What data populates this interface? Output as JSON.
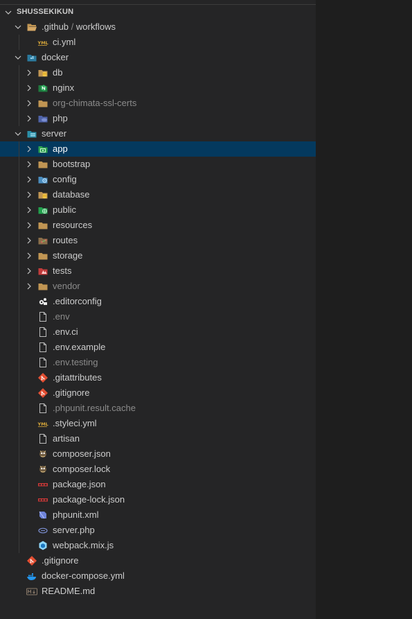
{
  "explorer": {
    "title": "SHUSSEKIKUN",
    "colors": {
      "background": "#252526",
      "selected": "#04395e",
      "text": "#cccccc",
      "dimmed": "#8b8b8b",
      "folder": "#c09553"
    },
    "items": [
      {
        "name": ".github",
        "label2": "workflows",
        "indent": 1,
        "kind": "folder",
        "expanded": true,
        "icon": "folder-open-icon"
      },
      {
        "name": "ci.yml",
        "indent": 2,
        "kind": "file",
        "icon": "yaml-icon"
      },
      {
        "name": "docker",
        "indent": 1,
        "kind": "folder",
        "expanded": true,
        "icon": "docker-folder-icon"
      },
      {
        "name": "db",
        "indent": 2,
        "kind": "folder",
        "expanded": false,
        "icon": "database-folder-icon"
      },
      {
        "name": "nginx",
        "indent": 2,
        "kind": "folder",
        "expanded": false,
        "icon": "nginx-folder-icon"
      },
      {
        "name": "org-chimata-ssl-certs",
        "indent": 2,
        "kind": "folder",
        "expanded": false,
        "icon": "folder-icon",
        "dimmed": true
      },
      {
        "name": "php",
        "indent": 2,
        "kind": "folder",
        "expanded": false,
        "icon": "php-folder-icon"
      },
      {
        "name": "server",
        "indent": 1,
        "kind": "folder",
        "expanded": true,
        "icon": "server-folder-icon"
      },
      {
        "name": "app",
        "indent": 2,
        "kind": "folder",
        "expanded": false,
        "icon": "app-folder-icon",
        "selected": true
      },
      {
        "name": "bootstrap",
        "indent": 2,
        "kind": "folder",
        "expanded": false,
        "icon": "folder-icon"
      },
      {
        "name": "config",
        "indent": 2,
        "kind": "folder",
        "expanded": false,
        "icon": "config-folder-icon"
      },
      {
        "name": "database",
        "indent": 2,
        "kind": "folder",
        "expanded": false,
        "icon": "database-folder-icon"
      },
      {
        "name": "public",
        "indent": 2,
        "kind": "folder",
        "expanded": false,
        "icon": "public-folder-icon"
      },
      {
        "name": "resources",
        "indent": 2,
        "kind": "folder",
        "expanded": false,
        "icon": "folder-icon"
      },
      {
        "name": "routes",
        "indent": 2,
        "kind": "folder",
        "expanded": false,
        "icon": "routes-folder-icon"
      },
      {
        "name": "storage",
        "indent": 2,
        "kind": "folder",
        "expanded": false,
        "icon": "folder-icon"
      },
      {
        "name": "tests",
        "indent": 2,
        "kind": "folder",
        "expanded": false,
        "icon": "tests-folder-icon"
      },
      {
        "name": "vendor",
        "indent": 2,
        "kind": "folder",
        "expanded": false,
        "icon": "folder-icon",
        "dimmed": true
      },
      {
        "name": ".editorconfig",
        "indent": 2,
        "kind": "file",
        "icon": "editorconfig-icon"
      },
      {
        "name": ".env",
        "indent": 2,
        "kind": "file",
        "icon": "file-icon",
        "dimmed": true
      },
      {
        "name": ".env.ci",
        "indent": 2,
        "kind": "file",
        "icon": "file-icon"
      },
      {
        "name": ".env.example",
        "indent": 2,
        "kind": "file",
        "icon": "file-icon"
      },
      {
        "name": ".env.testing",
        "indent": 2,
        "kind": "file",
        "icon": "file-icon",
        "dimmed": true
      },
      {
        "name": ".gitattributes",
        "indent": 2,
        "kind": "file",
        "icon": "git-icon"
      },
      {
        "name": ".gitignore",
        "indent": 2,
        "kind": "file",
        "icon": "git-icon"
      },
      {
        "name": ".phpunit.result.cache",
        "indent": 2,
        "kind": "file",
        "icon": "file-icon",
        "dimmed": true
      },
      {
        "name": ".styleci.yml",
        "indent": 2,
        "kind": "file",
        "icon": "yaml-icon"
      },
      {
        "name": "artisan",
        "indent": 2,
        "kind": "file",
        "icon": "file-icon"
      },
      {
        "name": "composer.json",
        "indent": 2,
        "kind": "file",
        "icon": "composer-icon"
      },
      {
        "name": "composer.lock",
        "indent": 2,
        "kind": "file",
        "icon": "composer-icon"
      },
      {
        "name": "package.json",
        "indent": 2,
        "kind": "file",
        "icon": "npm-icon"
      },
      {
        "name": "package-lock.json",
        "indent": 2,
        "kind": "file",
        "icon": "npm-icon"
      },
      {
        "name": "phpunit.xml",
        "indent": 2,
        "kind": "file",
        "icon": "phpunit-icon"
      },
      {
        "name": "server.php",
        "indent": 2,
        "kind": "file",
        "icon": "php-file-icon"
      },
      {
        "name": "webpack.mix.js",
        "indent": 2,
        "kind": "file",
        "icon": "webpack-icon"
      },
      {
        "name": ".gitignore",
        "indent": 1,
        "kind": "file",
        "icon": "git-icon"
      },
      {
        "name": "docker-compose.yml",
        "indent": 1,
        "kind": "file",
        "icon": "docker-icon"
      },
      {
        "name": "README.md",
        "indent": 1,
        "kind": "file",
        "icon": "markdown-icon"
      }
    ]
  }
}
